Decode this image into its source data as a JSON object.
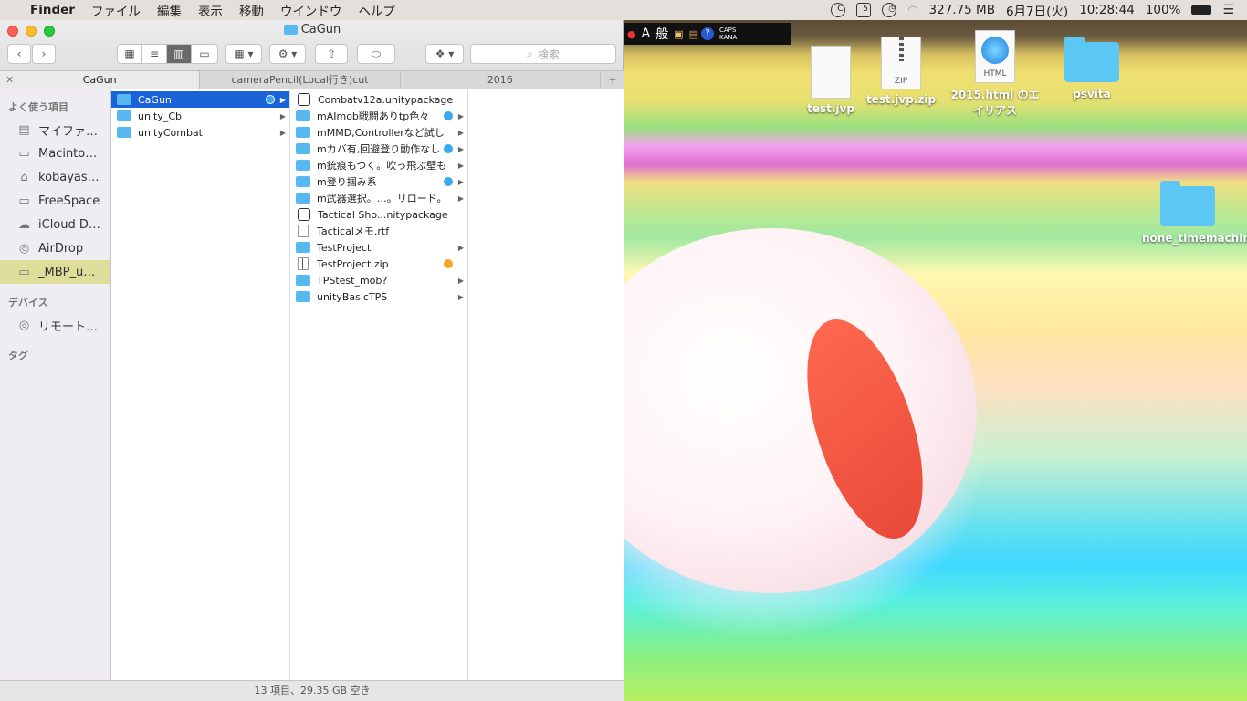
{
  "menubar": {
    "app": "Finder",
    "items": [
      "ファイル",
      "編集",
      "表示",
      "移動",
      "ウインドウ",
      "ヘルプ"
    ],
    "memory": "327.75 MB",
    "date": "6月7日(火)",
    "time": "10:28:44",
    "battery": "100%"
  },
  "imebar": {
    "mode": "A",
    "kanji": "般",
    "caps": "CAPS",
    "kana": "KANA"
  },
  "window": {
    "title": "CaGun",
    "search_placeholder": "検索",
    "tabs": [
      "CaGun",
      "cameraPencil(Local行き)cut",
      "2016"
    ],
    "status": "13 項目、29.35 GB 空き"
  },
  "sidebar": {
    "favorites_header": "よく使う項目",
    "favorites": [
      "マイファ…",
      "Macinto…",
      "kobayas…",
      "FreeSpace",
      "iCloud D…",
      "AirDrop",
      "_MBP_u…"
    ],
    "devices_header": "デバイス",
    "devices": [
      "リモート…"
    ],
    "tags_header": "タグ"
  },
  "column1": [
    "CaGun",
    "unity_Cb",
    "unityCombat"
  ],
  "column2": [
    {
      "name": "Combatv12a.unitypackage",
      "kind": "unity",
      "folder": false,
      "tag": ""
    },
    {
      "name": "mAImob戦闘ありtp色々",
      "kind": "folder",
      "folder": true,
      "tag": "#3aa9f0"
    },
    {
      "name": "mMMD,Controllerなど試し",
      "kind": "folder",
      "folder": true,
      "tag": ""
    },
    {
      "name": "mカバ有,回避登り動作なし",
      "kind": "folder",
      "folder": true,
      "tag": "#3aa9f0"
    },
    {
      "name": "m銃痕もつく。吹っ飛ぶ壁も",
      "kind": "folder",
      "folder": true,
      "tag": ""
    },
    {
      "name": "m登り掴み系",
      "kind": "folder",
      "folder": true,
      "tag": "#3aa9f0"
    },
    {
      "name": "m武器選択。…。リロード。",
      "kind": "folder",
      "folder": true,
      "tag": ""
    },
    {
      "name": "Tactical Sho...nitypackage",
      "kind": "unity",
      "folder": false,
      "tag": ""
    },
    {
      "name": "Tacticalメモ.rtf",
      "kind": "doc",
      "folder": false,
      "tag": ""
    },
    {
      "name": "TestProject",
      "kind": "folder",
      "folder": true,
      "tag": ""
    },
    {
      "name": "TestProject.zip",
      "kind": "zip",
      "folder": false,
      "tag": "#f5a623"
    },
    {
      "name": "TPStest_mob?",
      "kind": "folder",
      "folder": true,
      "tag": ""
    },
    {
      "name": "unityBasicTPS",
      "kind": "folder",
      "folder": true,
      "tag": ""
    }
  ],
  "desktop": {
    "icons": [
      "test.jvp",
      "test.jvp.zip",
      "2015.html のエイリアス",
      "psvita",
      "none_timemachine"
    ],
    "zip_label": "ZIP",
    "html_label": "HTML"
  },
  "colors": {
    "accent": "#1a63d8",
    "folder": "#58b8f0",
    "tag_blue": "#3aa9f0",
    "tag_orange": "#f5a623"
  }
}
